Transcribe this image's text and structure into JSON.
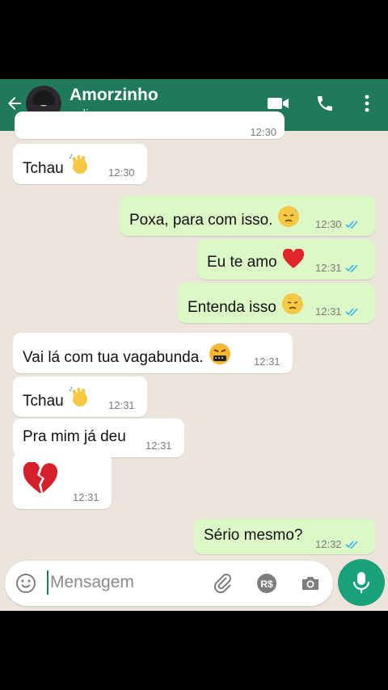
{
  "header": {
    "contact_name": "Amorzinho",
    "status": "online",
    "icons": [
      "back-arrow-icon",
      "video-call-icon",
      "phone-icon",
      "more-vert-icon"
    ],
    "color": "#1f7a5c"
  },
  "messages": [
    {
      "dir": "in",
      "text": "Tchau",
      "emoji": "waving-hand",
      "time": "12:30",
      "ticks": false
    },
    {
      "dir": "out",
      "text": "Poxa, para com isso.",
      "emoji": "sad-face",
      "time": "12:30",
      "ticks": true
    },
    {
      "dir": "out",
      "text": "Eu te amo",
      "emoji": "red-heart",
      "time": "12:31",
      "ticks": true
    },
    {
      "dir": "out",
      "text": "Entenda isso",
      "emoji": "sad-face",
      "time": "12:31",
      "ticks": true
    },
    {
      "dir": "in",
      "text": "Vai lá com tua vagabunda.",
      "emoji": "cursing-face",
      "time": "12:31",
      "ticks": false
    },
    {
      "dir": "in",
      "text": "Tchau",
      "emoji": "waving-hand",
      "time": "12:31",
      "ticks": false
    },
    {
      "dir": "in",
      "text": "Pra mim já deu",
      "emoji": "",
      "time": "12:31",
      "ticks": false
    },
    {
      "dir": "in",
      "text": "",
      "emoji": "broken-heart",
      "time": "12:31",
      "ticks": false
    },
    {
      "dir": "out",
      "text": "Sério mesmo?",
      "emoji": "",
      "time": "12:32",
      "ticks": true
    }
  ],
  "partial_top_time": "12:30",
  "input": {
    "placeholder": "Mensagem",
    "value": "",
    "icons": [
      "emoji-icon",
      "attach-icon",
      "payment-icon",
      "camera-icon",
      "mic-icon"
    ],
    "payment_label": "R$"
  },
  "colors": {
    "outgoing": "#dcf8c6",
    "incoming": "#ffffff",
    "background": "#ece5dd",
    "tick_read": "#34b7f1",
    "mic": "#1aa37a"
  }
}
